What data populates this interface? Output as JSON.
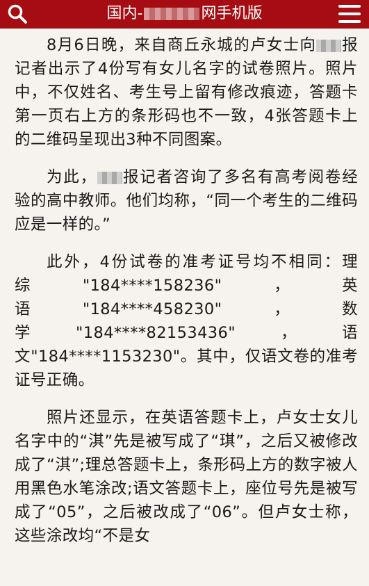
{
  "header": {
    "title_prefix": "国内-",
    "title_suffix": "网手机版",
    "accent_color": "#a60d12",
    "search_icon": "search-icon",
    "menu_icon": "hamburger-menu-icon"
  },
  "article": {
    "p1": {
      "a": "8月6日晚，来自商丘永城的卢女士向",
      "b": "报记者出示了4份写有女儿名字的试卷照片。照片中，不仅姓名、考生号上留有修改痕迹，答题卡第一页右上方的条形码也不一致，4张答题卡上的二维码呈现出3种不同图案。"
    },
    "p2": {
      "a": "为此，",
      "b": "报记者咨询了多名有高考阅卷经验的高中教师。他们均称，“同一个考生的二维码应是一样的。”"
    },
    "p3": "此外，4份试卷的准考证号均不相同：理综\"184****158236\"，英语\"184****458230\"，数学\"184****82153436\"，语文\"184****1153230\"。其中，仅语文卷的准考证号正确。",
    "p4": "照片还显示，在英语答题卡上，卢女士女儿名字中的“淇”先是被写成了“琪”，之后又被修改成了“淇”;理总答题卡上，条形码上方的数字被人用黑色水笔涂改;语文答题卡上，座位号先是被写成了“05”，之后被改成了“06”。但卢女士称，这些涂改均“不是女"
  }
}
